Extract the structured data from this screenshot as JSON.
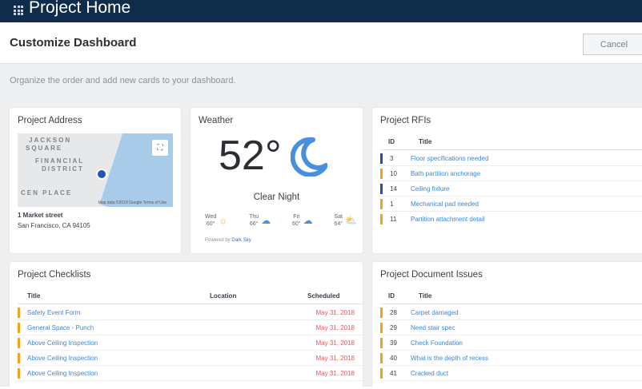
{
  "app": {
    "title": "Project Home"
  },
  "header": {
    "title": "Customize Dashboard",
    "cancel_label": "Cancel"
  },
  "subtext": "Organize the order and add new cards to your dashboard.",
  "colors": {
    "topbar": "#0f2c4b",
    "link": "#3f86d6",
    "date_red": "#e05a5a",
    "marker_blue": "#1f4fa8",
    "marker_orange": "#f0a21b"
  },
  "address_card": {
    "title": "Project Address",
    "map_labels": [
      "JACKSON",
      "SQUARE",
      "FINANCIAL",
      "DISTRICT",
      "CEN PLACE"
    ],
    "map_attribution": "Map data ©2018 Google   Terms of Use",
    "line1": "1 Market street",
    "line2": "San Francisco, CA 94105"
  },
  "weather_card": {
    "title": "Weather",
    "temperature": "52°",
    "condition": "Clear Night",
    "forecast": [
      {
        "day": "Wed",
        "temp": "60°",
        "icon": "sun-icon"
      },
      {
        "day": "Thu",
        "temp": "66°",
        "icon": "cloud-icon"
      },
      {
        "day": "Fri",
        "temp": "60°",
        "icon": "cloud-icon"
      },
      {
        "day": "Sat",
        "temp": "64°",
        "icon": "partly-cloudy-icon"
      }
    ],
    "powered_prefix": "Powered by",
    "powered_link": "Dark Sky"
  },
  "rfis_card": {
    "title": "Project RFIs",
    "columns": {
      "id": "ID",
      "title": "Title"
    },
    "rows": [
      {
        "id": "3",
        "title": "Floor specifications needed",
        "marker": "blue"
      },
      {
        "id": "10",
        "title": "Bath partition anchorage",
        "marker": "orange"
      },
      {
        "id": "14",
        "title": "Ceiling fixture",
        "marker": "blue"
      },
      {
        "id": "1",
        "title": "Mechanical pad needed",
        "marker": "orange"
      },
      {
        "id": "11",
        "title": "Partition attachment detail",
        "marker": "orange"
      }
    ]
  },
  "checklists_card": {
    "title": "Project Checklists",
    "columns": {
      "title": "Title",
      "location": "Location",
      "scheduled": "Scheduled"
    },
    "rows": [
      {
        "title": "Safety Event Form",
        "scheduled": "May 31, 2018"
      },
      {
        "title": "General Space - Punch",
        "scheduled": "May 31, 2018"
      },
      {
        "title": "Above Ceiling Inspection",
        "scheduled": "May 31, 2018"
      },
      {
        "title": "Above Ceiling Inspection",
        "scheduled": "May 31, 2018"
      },
      {
        "title": "Above Ceiling Inspection",
        "scheduled": "May 31, 2018"
      }
    ]
  },
  "issues_card": {
    "title": "Project Document Issues",
    "columns": {
      "id": "ID",
      "title": "Title"
    },
    "rows": [
      {
        "id": "28",
        "title": "Carpet damaged"
      },
      {
        "id": "29",
        "title": "Need stair spec"
      },
      {
        "id": "39",
        "title": "Check Foundation"
      },
      {
        "id": "40",
        "title": "What is the depth of recess"
      },
      {
        "id": "41",
        "title": "Cracked duct"
      }
    ]
  }
}
